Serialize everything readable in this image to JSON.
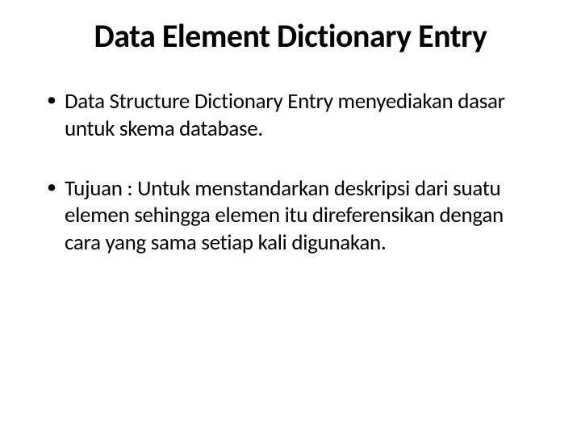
{
  "slide": {
    "title": "Data Element Dictionary Entry",
    "bullets": [
      "Data Structure Dictionary Entry menyediakan dasar untuk skema database.",
      "Tujuan : Untuk menstandarkan deskripsi dari suatu elemen sehingga elemen itu direferensikan dengan cara yang sama setiap kali digunakan."
    ]
  }
}
